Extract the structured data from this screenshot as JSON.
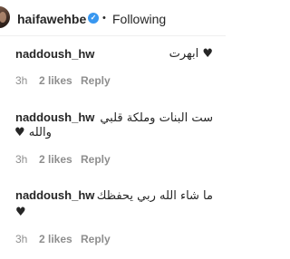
{
  "header": {
    "username": "haifawehbe",
    "verified_mark": "✓",
    "separator": "•",
    "follow_status": "Following"
  },
  "comments": [
    {
      "username": "naddoush_hw",
      "text": "♥ ابهرت",
      "time": "3h",
      "likes": "2 likes",
      "reply": "Reply"
    },
    {
      "username": "naddoush_hw",
      "text_line1": "ست البنات وملكة قلبي",
      "text_line2": "والله ♥",
      "time": "3h",
      "likes": "2 likes",
      "reply": "Reply"
    },
    {
      "username": "naddoush_hw",
      "text_line1": "ما شاء الله ربي يحفظك",
      "text_line2": "♥",
      "time": "3h",
      "likes": "2 likes",
      "reply": "Reply"
    }
  ],
  "icons": [
    "avatar",
    "verified-badge-icon",
    "heart-emoji-icon"
  ],
  "colors": {
    "text": "#262626",
    "muted": "#8e8e8e",
    "verified": "#3897f0",
    "divider": "#efefef"
  }
}
